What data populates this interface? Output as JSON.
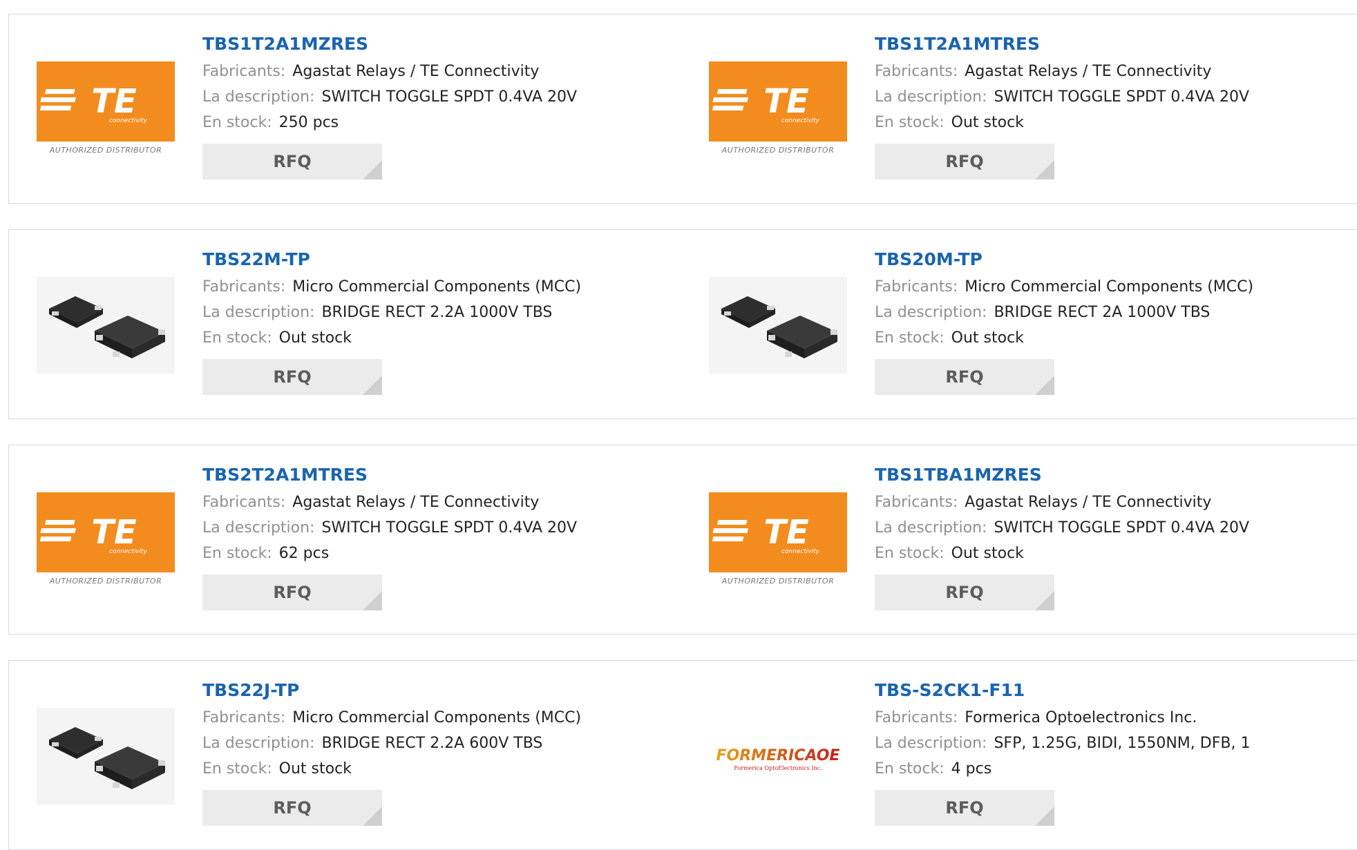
{
  "labels": {
    "manufacturer": "Fabricants:",
    "description": "La description:",
    "stock": "En stock:",
    "rfq": "RFQ"
  },
  "logos": {
    "te_text": "TE",
    "te_sub": "connectivity",
    "te_caption": "AUTHORIZED DISTRIBUTOR",
    "formerica_text": "FORMERICAOE",
    "formerica_sub": "Formerica OptoElectronics Inc."
  },
  "colors": {
    "te_orange": "#f28c1e",
    "part_link": "#1a64b0",
    "rfq_bg": "#ebebeb"
  },
  "products": [
    {
      "part": "TBS1T2A1MZRES",
      "manufacturer": "Agastat Relays / TE Connectivity",
      "description": "SWITCH TOGGLE SPDT 0.4VA 20V",
      "stock": "250 pcs",
      "image": "te-logo"
    },
    {
      "part": "TBS1T2A1MTRES",
      "manufacturer": "Agastat Relays / TE Connectivity",
      "description": "SWITCH TOGGLE SPDT 0.4VA 20V",
      "stock": "Out stock",
      "image": "te-logo"
    },
    {
      "part": "TBS22M-TP",
      "manufacturer": "Micro Commercial Components (MCC)",
      "description": "BRIDGE RECT 2.2A 1000V TBS",
      "stock": "Out stock",
      "image": "chip"
    },
    {
      "part": "TBS20M-TP",
      "manufacturer": "Micro Commercial Components (MCC)",
      "description": "BRIDGE RECT 2A 1000V TBS",
      "stock": "Out stock",
      "image": "chip"
    },
    {
      "part": "TBS2T2A1MTRES",
      "manufacturer": "Agastat Relays / TE Connectivity",
      "description": "SWITCH TOGGLE SPDT 0.4VA 20V",
      "stock": "62 pcs",
      "image": "te-logo"
    },
    {
      "part": "TBS1TBA1MZRES",
      "manufacturer": "Agastat Relays / TE Connectivity",
      "description": "SWITCH TOGGLE SPDT 0.4VA 20V",
      "stock": "Out stock",
      "image": "te-logo"
    },
    {
      "part": "TBS22J-TP",
      "manufacturer": "Micro Commercial Components (MCC)",
      "description": "BRIDGE RECT 2.2A 600V TBS",
      "stock": "Out stock",
      "image": "chip"
    },
    {
      "part": "TBS-S2CK1-F11",
      "manufacturer": "Formerica Optoelectronics Inc.",
      "description": "SFP, 1.25G, BIDI, 1550NM, DFB, 1",
      "stock": "4 pcs",
      "image": "formerica-logo"
    }
  ]
}
